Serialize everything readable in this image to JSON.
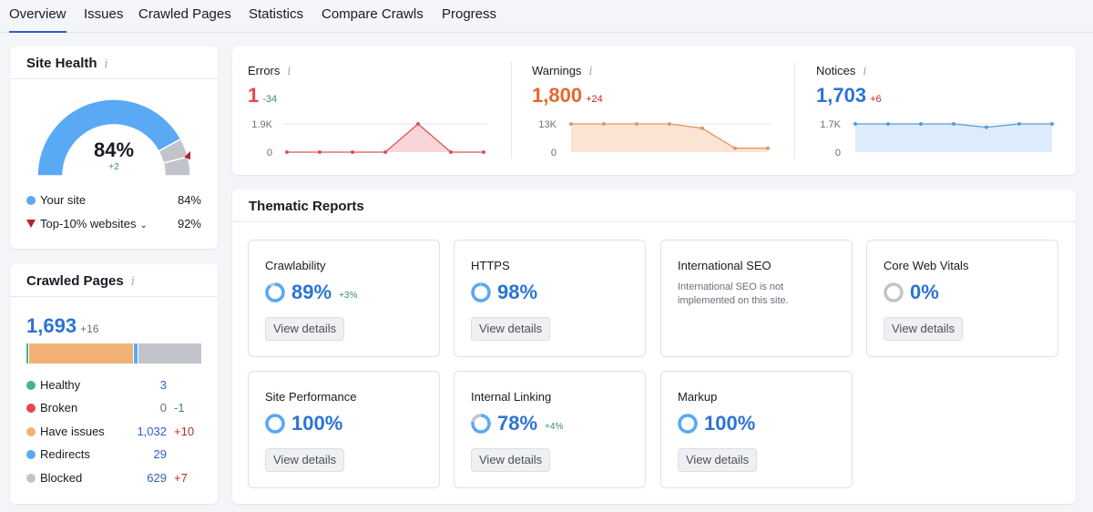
{
  "tabs": [
    {
      "label": "Overview",
      "active": true
    },
    {
      "label": "Issues"
    },
    {
      "label": "Crawled Pages"
    },
    {
      "label": "Statistics"
    },
    {
      "label": "Compare Crawls"
    },
    {
      "label": "Progress"
    }
  ],
  "site_health": {
    "title": "Site Health",
    "info_icon": "i",
    "value": "84%",
    "value_pct": 84,
    "delta": "+2",
    "top10_pct": 92,
    "legend": [
      {
        "label": "Your site",
        "value": "84%",
        "color": "#5aa9f5"
      },
      {
        "label": "Top-10% websites",
        "value": "92%",
        "color": "#b7212c"
      }
    ]
  },
  "crawled_pages": {
    "title": "Crawled Pages",
    "info_icon": "i",
    "total": "1,693",
    "total_delta": "+16",
    "rows": [
      {
        "label": "Healthy",
        "value": "3",
        "count": 3,
        "delta": "",
        "color": "#46b583"
      },
      {
        "label": "Broken",
        "value": "0",
        "count": 0,
        "delta": "-1",
        "delta_color": "#3a8e66",
        "color": "#e5474e"
      },
      {
        "label": "Have issues",
        "value": "1,032",
        "count": 1032,
        "delta": "+10",
        "delta_color": "#c1272d",
        "color": "#f2b277"
      },
      {
        "label": "Redirects",
        "value": "29",
        "count": 29,
        "delta": "",
        "color": "#5aa9f5"
      },
      {
        "label": "Blocked",
        "value": "629",
        "count": 629,
        "delta": "+7",
        "delta_color": "#c1272d",
        "color": "#c2c4cb"
      }
    ]
  },
  "issues_summary": [
    {
      "label": "Errors",
      "value": "1",
      "delta": "-34",
      "value_color": "#e5474e",
      "delta_color": "#3a8e66",
      "y_labels": [
        "1.9K",
        "0"
      ],
      "y_max": 1900,
      "line_color": "#d9535f",
      "fill_color": "#f8d5d7",
      "points": [
        0,
        0,
        0,
        0,
        1900,
        0,
        0
      ]
    },
    {
      "label": "Warnings",
      "value": "1,800",
      "delta": "+24",
      "value_color": "#e6682e",
      "delta_color": "#c1272d",
      "y_labels": [
        "13K",
        "0"
      ],
      "y_max": 13000,
      "line_color": "#e3965f",
      "fill_color": "#fce4d4",
      "points": [
        13000,
        13000,
        13000,
        13000,
        11000,
        1800,
        1800
      ]
    },
    {
      "label": "Notices",
      "value": "1,703",
      "delta": "+6",
      "value_color": "#2c73d6",
      "delta_color": "#c1272d",
      "y_labels": [
        "1.7K",
        "0"
      ],
      "y_max": 1700,
      "line_color": "#5b9bd8",
      "fill_color": "#dcecfb",
      "points": [
        1700,
        1700,
        1700,
        1700,
        1500,
        1700,
        1700
      ]
    }
  ],
  "thematic": {
    "title": "Thematic Reports",
    "button_label": "View details",
    "reports": [
      {
        "title": "Crawlability",
        "value": "89%",
        "pct": 89,
        "delta": "+3%"
      },
      {
        "title": "HTTPS",
        "value": "98%",
        "pct": 98,
        "delta": ""
      },
      {
        "title": "International SEO",
        "note": "International SEO is not implemented on this site."
      },
      {
        "title": "Core Web Vitals",
        "value": "0%",
        "pct": 0,
        "delta": ""
      },
      {
        "title": "Site Performance",
        "value": "100%",
        "pct": 100,
        "delta": ""
      },
      {
        "title": "Internal Linking",
        "value": "78%",
        "pct": 78,
        "delta": "+4%"
      },
      {
        "title": "Markup",
        "value": "100%",
        "pct": 100,
        "delta": ""
      }
    ]
  }
}
